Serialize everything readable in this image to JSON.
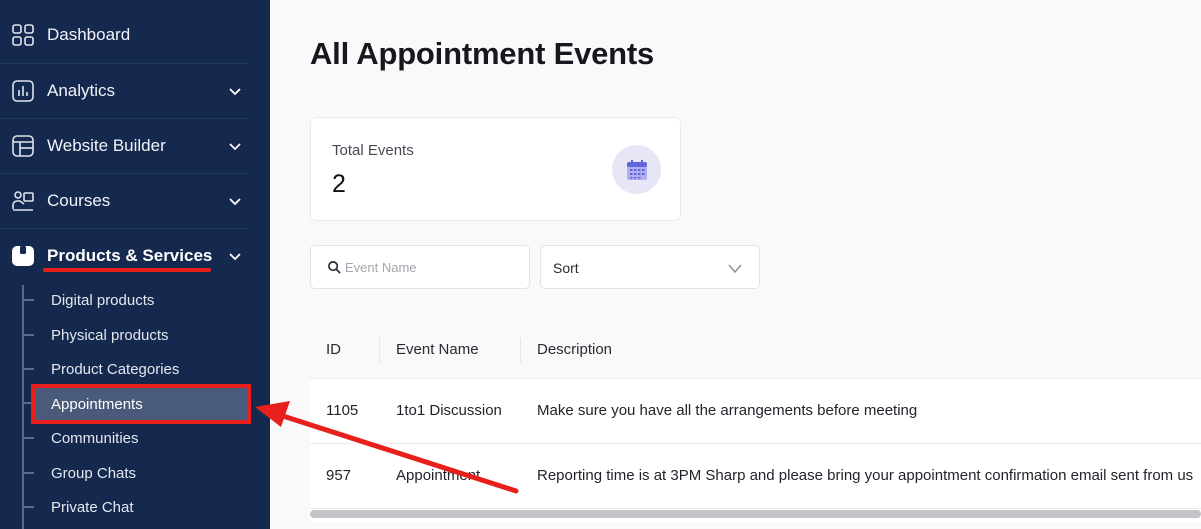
{
  "sidebar": {
    "nav": [
      {
        "label": "Dashboard",
        "icon": "grid-icon",
        "has_chevron": false
      },
      {
        "label": "Analytics",
        "icon": "bar-chart-icon",
        "has_chevron": true
      },
      {
        "label": "Website Builder",
        "icon": "layout-icon",
        "has_chevron": true
      },
      {
        "label": "Courses",
        "icon": "person-board-icon",
        "has_chevron": true
      },
      {
        "label": "Products & Services",
        "icon": "box-icon",
        "has_chevron": true,
        "expanded": true
      }
    ],
    "sub_items": [
      {
        "label": "Digital products"
      },
      {
        "label": "Physical products"
      },
      {
        "label": "Product Categories"
      },
      {
        "label": "Appointments",
        "active": true
      },
      {
        "label": "Communities"
      },
      {
        "label": "Group Chats"
      },
      {
        "label": "Private Chat"
      }
    ]
  },
  "main": {
    "title": "All Appointment Events",
    "stat": {
      "label": "Total Events",
      "value": "2",
      "icon": "calendar-icon"
    },
    "search": {
      "placeholder": "Event Name",
      "icon": "search-icon"
    },
    "sort": {
      "label": "Sort"
    },
    "table": {
      "columns": [
        "ID",
        "Event Name",
        "Description"
      ],
      "rows": [
        {
          "id": "1105",
          "name": "1to1 Discussion",
          "description": "Make sure you have all the arrangements before meeting"
        },
        {
          "id": "957",
          "name": "Appointment",
          "description": "Reporting time is at 3PM Sharp and please bring your appointment confirmation email sent from us"
        }
      ]
    }
  },
  "colors": {
    "sidebar_bg": "#15294e",
    "active_bg": "#4a5a7a",
    "annotation_red": "#e8201c",
    "stat_icon_bg": "#e6e6f7",
    "stat_icon_fg": "#5b5bd6"
  }
}
